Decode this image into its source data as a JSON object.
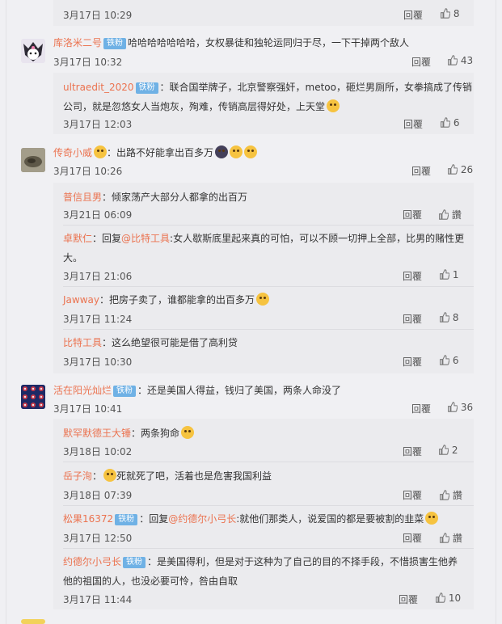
{
  "colors": {
    "accent": "#eb7350",
    "badge": "#6fb1e5",
    "link": "#eb7350"
  },
  "top": {
    "time": "3月17日 10:29",
    "reply": "回覆",
    "likes": "8"
  },
  "c1": {
    "user": "库洛米二号",
    "badge": "铁粉",
    "text": "哈哈哈哈哈哈哈，女权暴徒和独轮运同归于尽，一下干掉两个敌人",
    "time": "3月17日 10:32",
    "reply": "回覆",
    "likes": "43",
    "r1": {
      "user": "ultraedit_2020",
      "badge": "铁粉",
      "text1": "：联合国举牌子，北京警察强奸，metoo，砸烂男厕所，女拳搞成了传销",
      "text2": "公司，就是忽悠女人当炮灰，殉难，传销高层得好处，上天堂",
      "time": "3月17日 12:03",
      "reply": "回覆",
      "likes": "6"
    }
  },
  "c2": {
    "user": "传奇小威",
    "text": "：出路不好能拿出百多万",
    "time": "3月17日 10:26",
    "reply": "回覆",
    "likes": "26",
    "r1": {
      "user": "普信且男",
      "text": "：倾家荡产大部分人都拿的出百万",
      "time": "3月21日 06:09",
      "reply": "回覆",
      "likes": "讚"
    },
    "r2": {
      "user": "卓默仁",
      "pre": "：回复",
      "mention": "@比特工具",
      "text1": ":女人歇斯底里起来真的可怕，可以不顾一切押上全部，比男的赌性更",
      "text2": "大。",
      "time": "3月17日 21:06",
      "reply": "回覆",
      "likes": "1"
    },
    "r3": {
      "user": "Jawway",
      "text": "：把房子卖了，谁都能拿的出百多万",
      "time": "3月17日 11:24",
      "reply": "回覆",
      "likes": "8"
    },
    "r4": {
      "user": "比特工具",
      "text": "：这么绝望很可能是借了高利贷",
      "time": "3月17日 10:30",
      "reply": "回覆",
      "likes": "6"
    }
  },
  "c3": {
    "user": "活在阳光灿烂",
    "badge": "铁粉",
    "text": "：还是美国人得益，钱归了美国，两条人命没了",
    "time": "3月17日 10:41",
    "reply": "回覆",
    "likes": "36",
    "r1": {
      "user": "默罕默德王大锤",
      "text": "：两条狗命",
      "time": "3月18日 10:02",
      "reply": "回覆",
      "likes": "2"
    },
    "r2": {
      "user": "岳子洵",
      "text": "死就死了吧，活着也是危害我国利益",
      "time": "3月18日 07:39",
      "reply": "回覆",
      "likes": "讚"
    },
    "r3": {
      "user": "松果16372",
      "badge": "铁粉",
      "pre": "：回复",
      "mention": "@约德尔小弓长",
      "text": ":就他们那类人，说爱国的都是要被割的韭菜",
      "time": "3月17日 12:50",
      "reply": "回覆",
      "likes": "讚"
    },
    "r4": {
      "user": "约德尔小弓长",
      "badge": "铁粉",
      "text1": "：是美国得利，但是对于这种为了自己的目的不择手段，不惜损害生他养",
      "text2": "他的祖国的人，也没必要可怜，咎由自取",
      "time": "3月17日 11:44",
      "reply": "回覆",
      "likes": "10"
    }
  }
}
